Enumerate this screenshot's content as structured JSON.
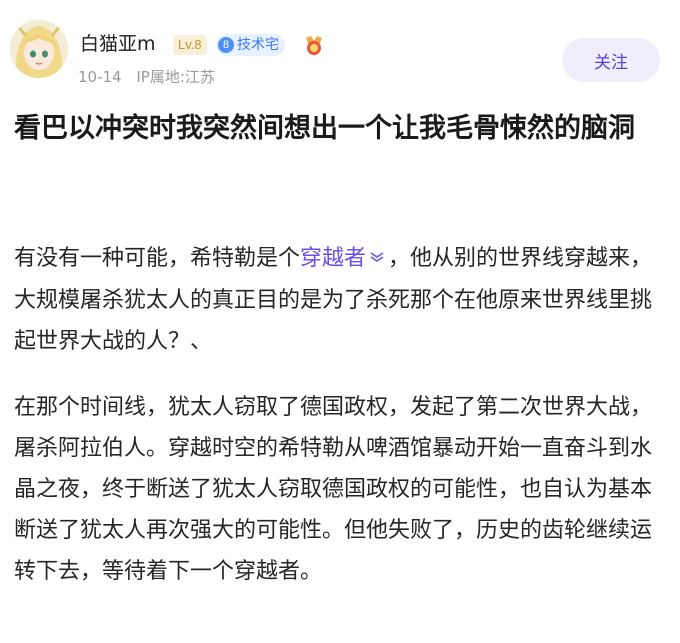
{
  "author": {
    "name": "白猫亚m",
    "level": "Lv.8",
    "tech_badge_num": "8",
    "tech_badge_label": "技术宅",
    "date": "10-14",
    "location": "IP属地:江苏"
  },
  "follow_label": "关注",
  "post": {
    "title": "看巴以冲突时我突然间想出一个让我毛骨悚然的脑洞",
    "p1_before": "有没有一种可能，希特勒是个",
    "p1_link": "穿越者",
    "p1_after": "，他从别的世界线穿越来，大规模屠杀犹太人的真正目的是为了杀死那个在他原来世界线里挑起世界大战的人？、",
    "p2": "在那个时间线，犹太人窃取了德国政权，发起了第二次世界大战，屠杀阿拉伯人。穿越时空的希特勒从啤酒馆暴动开始一直奋斗到水晶之夜，终于断送了犹太人窃取德国政权的可能性，也自认为基本断送了犹太人再次强大的可能性。但他失败了，历史的齿轮继续运转下去，等待着下一个穿越者。"
  },
  "colors": {
    "accent": "#6b4ee6",
    "level": "#c8932f",
    "tech": "#3b7cf0"
  }
}
